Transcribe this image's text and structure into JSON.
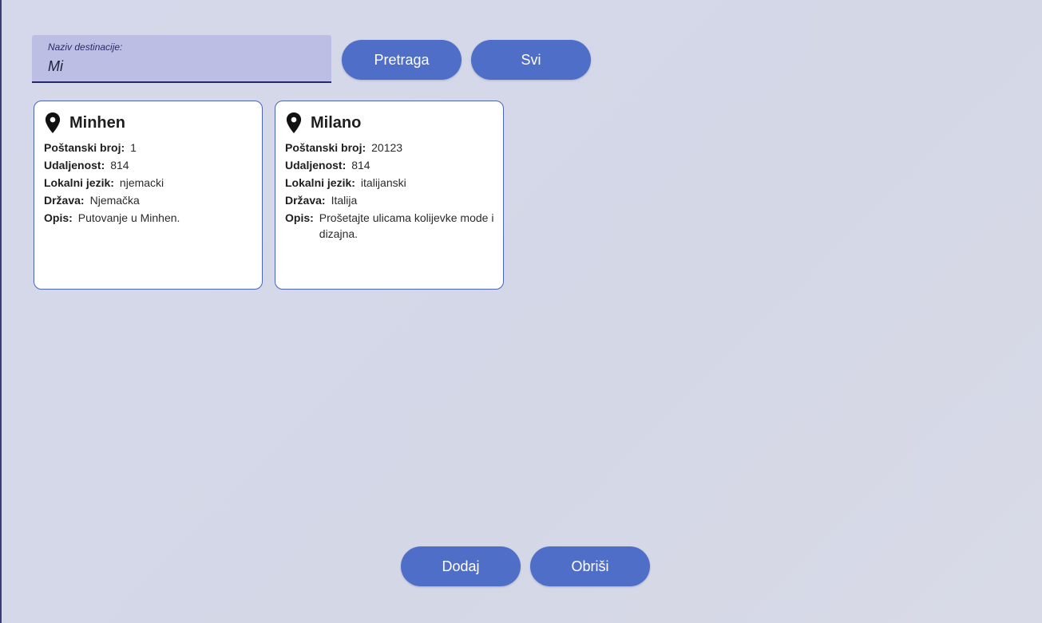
{
  "search": {
    "label": "Naziv destinacije:",
    "value": "Mi"
  },
  "buttons": {
    "search": "Pretraga",
    "all": "Svi",
    "add": "Dodaj",
    "delete": "Obriši"
  },
  "field_labels": {
    "postal": "Poštanski broj:",
    "distance": "Udaljenost:",
    "language": "Lokalni jezik:",
    "country": "Država:",
    "description": "Opis:"
  },
  "destinations": [
    {
      "name": "Minhen",
      "postal": "1",
      "distance": "814",
      "language": "njemacki",
      "country": "Njemačka",
      "description": "Putovanje u Minhen."
    },
    {
      "name": "Milano",
      "postal": "20123",
      "distance": "814",
      "language": "italijanski",
      "country": "Italija",
      "description": "Prošetajte ulicama kolijevke mode i dizajna."
    }
  ],
  "icons": {
    "card_icon": "location-pin-icon"
  },
  "colors": {
    "button": "#4f6ec7",
    "card_border": "#4b63b8",
    "search_bg": "#bcbfe3"
  }
}
